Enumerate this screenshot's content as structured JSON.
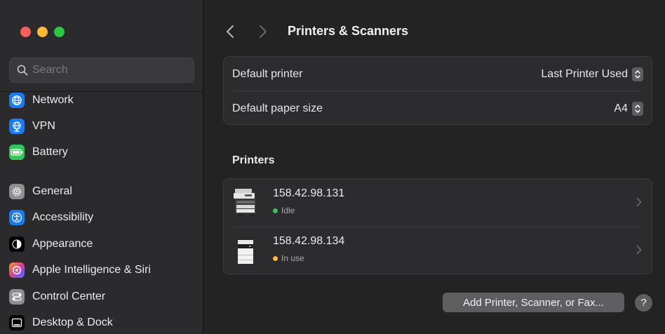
{
  "sidebar": {
    "search": {
      "placeholder": "Search"
    },
    "items": [
      {
        "label": "Network",
        "icon": "globe-icon",
        "color": "#1a7cf5"
      },
      {
        "label": "VPN",
        "icon": "vpn-icon",
        "color": "#1a7cf5"
      },
      {
        "label": "Battery",
        "icon": "battery-icon",
        "color": "#33c759"
      },
      {
        "label": "General",
        "icon": "gear-icon",
        "color": "#8e8e93"
      },
      {
        "label": "Accessibility",
        "icon": "accessibility-icon",
        "color": "#1a7cf5"
      },
      {
        "label": "Appearance",
        "icon": "appearance-icon",
        "color": "#000000"
      },
      {
        "label": "Apple Intelligence & Siri",
        "icon": "siri-icon",
        "color": "#b44ee8"
      },
      {
        "label": "Control Center",
        "icon": "control-center-icon",
        "color": "#8e8e93"
      },
      {
        "label": "Desktop & Dock",
        "icon": "dock-icon",
        "color": "#000000"
      }
    ]
  },
  "header": {
    "title": "Printers & Scanners"
  },
  "defaults": {
    "printer_label": "Default printer",
    "printer_value": "Last Printer Used",
    "paper_label": "Default paper size",
    "paper_value": "A4"
  },
  "printers": {
    "title": "Printers",
    "items": [
      {
        "name": "158.42.98.131",
        "status": "Idle",
        "status_color": "#33c759"
      },
      {
        "name": "158.42.98.134",
        "status": "In use",
        "status_color": "#febc2e"
      }
    ]
  },
  "actions": {
    "add_label": "Add Printer, Scanner, or Fax...",
    "help_label": "?"
  }
}
